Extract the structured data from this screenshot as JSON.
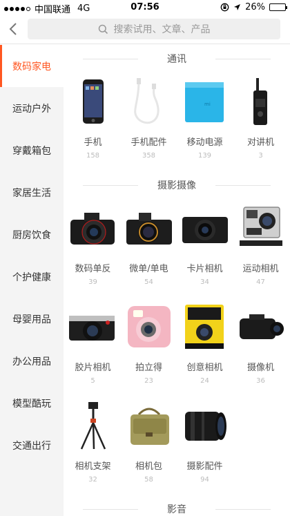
{
  "status_bar": {
    "carrier": "中国联通",
    "network": "4G",
    "time": "07:56",
    "battery": "26%",
    "battery_level": 0.26
  },
  "search": {
    "placeholder": "搜索试用、文章、产品"
  },
  "sidebar": {
    "items": [
      {
        "label": "数码家电",
        "active": true
      },
      {
        "label": "运动户外"
      },
      {
        "label": "穿戴箱包"
      },
      {
        "label": "家居生活"
      },
      {
        "label": "厨房饮食"
      },
      {
        "label": "个护健康"
      },
      {
        "label": "母婴用品"
      },
      {
        "label": "办公用品"
      },
      {
        "label": "模型酷玩"
      },
      {
        "label": "交通出行"
      }
    ]
  },
  "sections": [
    {
      "title": "通讯",
      "items": [
        {
          "name": "手机",
          "count": "158",
          "icon": "smartphone-icon"
        },
        {
          "name": "手机配件",
          "count": "358",
          "icon": "cable-icon"
        },
        {
          "name": "移动电源",
          "count": "139",
          "icon": "power-bank-icon"
        },
        {
          "name": "对讲机",
          "count": "3",
          "icon": "walkie-talkie-icon"
        }
      ]
    },
    {
      "title": "摄影摄像",
      "items": [
        {
          "name": "数码单反",
          "count": "39",
          "icon": "dslr-icon"
        },
        {
          "name": "微单/单电",
          "count": "54",
          "icon": "mirrorless-icon"
        },
        {
          "name": "卡片相机",
          "count": "34",
          "icon": "compact-camera-icon"
        },
        {
          "name": "运动相机",
          "count": "47",
          "icon": "action-camera-icon"
        },
        {
          "name": "胶片相机",
          "count": "5",
          "icon": "film-camera-icon"
        },
        {
          "name": "拍立得",
          "count": "23",
          "icon": "instax-icon"
        },
        {
          "name": "创意相机",
          "count": "24",
          "icon": "creative-camera-icon"
        },
        {
          "name": "摄像机",
          "count": "36",
          "icon": "camcorder-icon"
        },
        {
          "name": "相机支架",
          "count": "32",
          "icon": "tripod-icon"
        },
        {
          "name": "相机包",
          "count": "58",
          "icon": "camera-bag-icon"
        },
        {
          "name": "摄影配件",
          "count": "94",
          "icon": "lens-icon"
        }
      ]
    },
    {
      "title": "影音",
      "items": []
    }
  ]
}
